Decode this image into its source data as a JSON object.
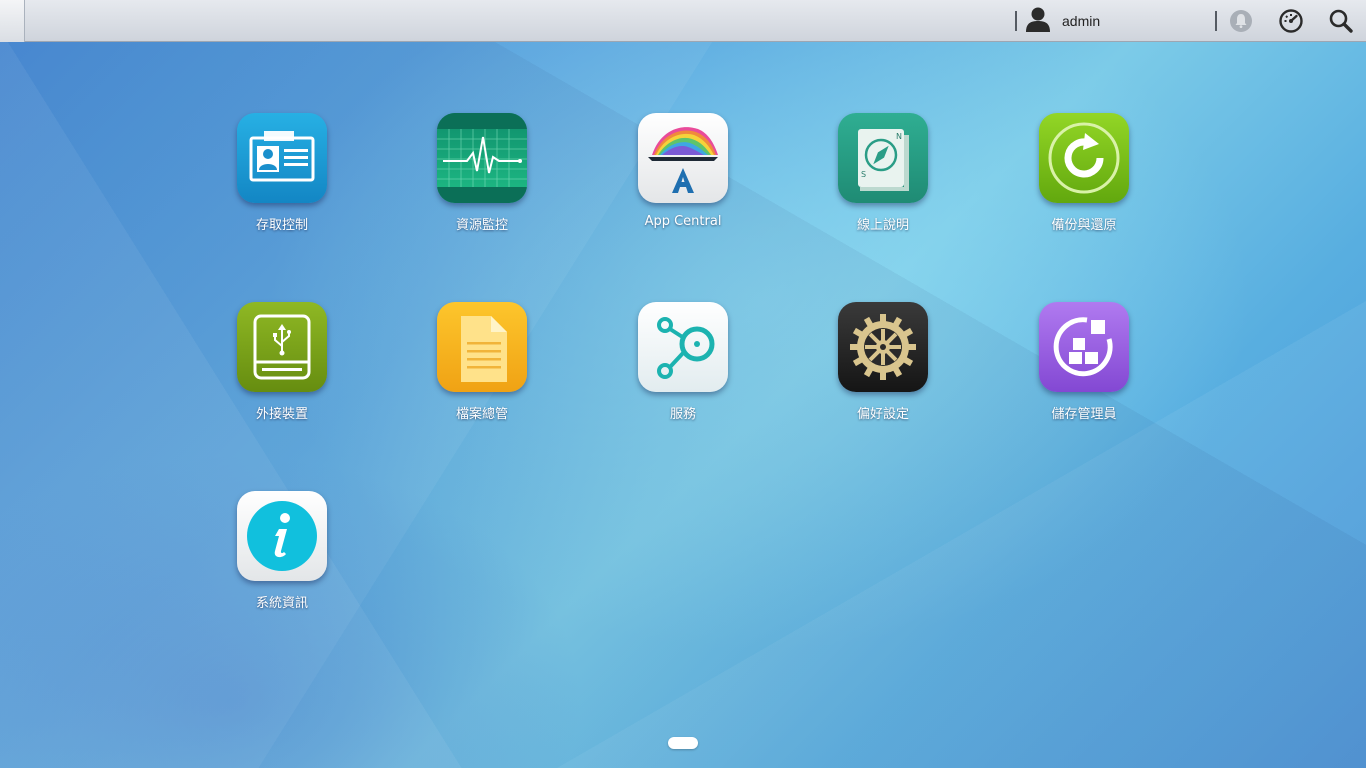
{
  "topbar": {
    "username": "admin",
    "icons": [
      "user-icon",
      "notification-icon",
      "dashboard-gauge-icon",
      "search-icon"
    ]
  },
  "apps": [
    {
      "label": "存取控制",
      "icon": "access-control-icon",
      "color": "#1ea0d5"
    },
    {
      "label": "資源監控",
      "icon": "resource-monitor-icon",
      "color": "#1aa67a"
    },
    {
      "label": "App Central",
      "icon": "app-central-icon",
      "color": "#f2f2f2"
    },
    {
      "label": "線上說明",
      "icon": "online-help-icon",
      "color": "#2a9d86"
    },
    {
      "label": "備份與還原",
      "icon": "backup-restore-icon",
      "color": "#7cc21a"
    },
    {
      "label": "外接裝置",
      "icon": "external-devices-icon",
      "color": "#7ea71a"
    },
    {
      "label": "檔案總管",
      "icon": "file-explorer-icon",
      "color": "#f4b41a"
    },
    {
      "label": "服務",
      "icon": "services-icon",
      "color": "#f2f5f6"
    },
    {
      "label": "偏好設定",
      "icon": "preferences-gear-icon",
      "color": "#2a2a2a"
    },
    {
      "label": "儲存管理員",
      "icon": "storage-manager-icon",
      "color": "#9a5fe0"
    },
    {
      "label": "系統資訊",
      "icon": "system-info-icon",
      "color": "#f2f2f2"
    }
  ]
}
